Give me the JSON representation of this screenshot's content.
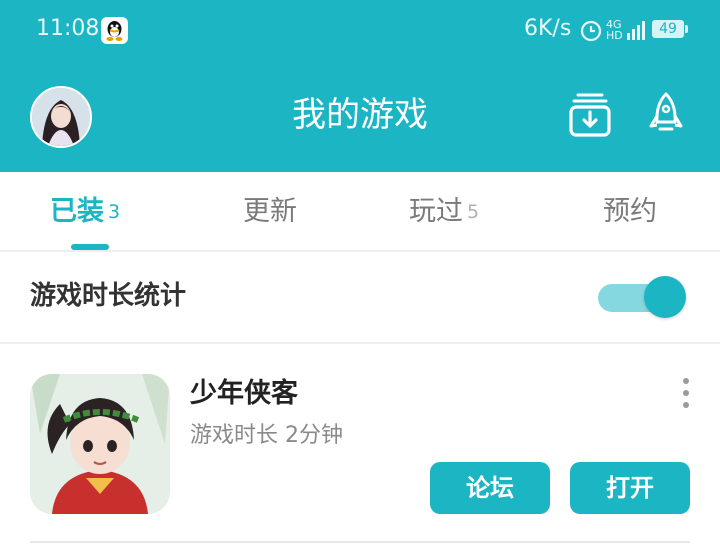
{
  "status_bar": {
    "time": "11:08",
    "net_speed": "6K/s",
    "network_label": "4G",
    "hd_label": "HD",
    "battery": "49",
    "icons": [
      "qq-icon",
      "alarm-icon",
      "signal-icon",
      "battery-icon"
    ]
  },
  "header": {
    "title": "我的游戏",
    "icons": [
      "avatar",
      "download-icon",
      "rocket-icon"
    ]
  },
  "tabs": [
    {
      "label": "已装",
      "count": "3",
      "active": true
    },
    {
      "label": "更新",
      "count": "",
      "active": false
    },
    {
      "label": "玩过",
      "count": "5",
      "active": false
    },
    {
      "label": "预约",
      "count": "",
      "active": false
    }
  ],
  "stats": {
    "label": "游戏时长统计",
    "toggle_on": true
  },
  "games": [
    {
      "name": "少年侠客",
      "play_time": "游戏时长 2分钟",
      "forum_label": "论坛",
      "open_label": "打开"
    }
  ],
  "colors": {
    "accent": "#1bb5c4",
    "toggle_track": "#86d8e0",
    "text_primary": "#222222",
    "text_secondary": "#8a8a8a"
  }
}
